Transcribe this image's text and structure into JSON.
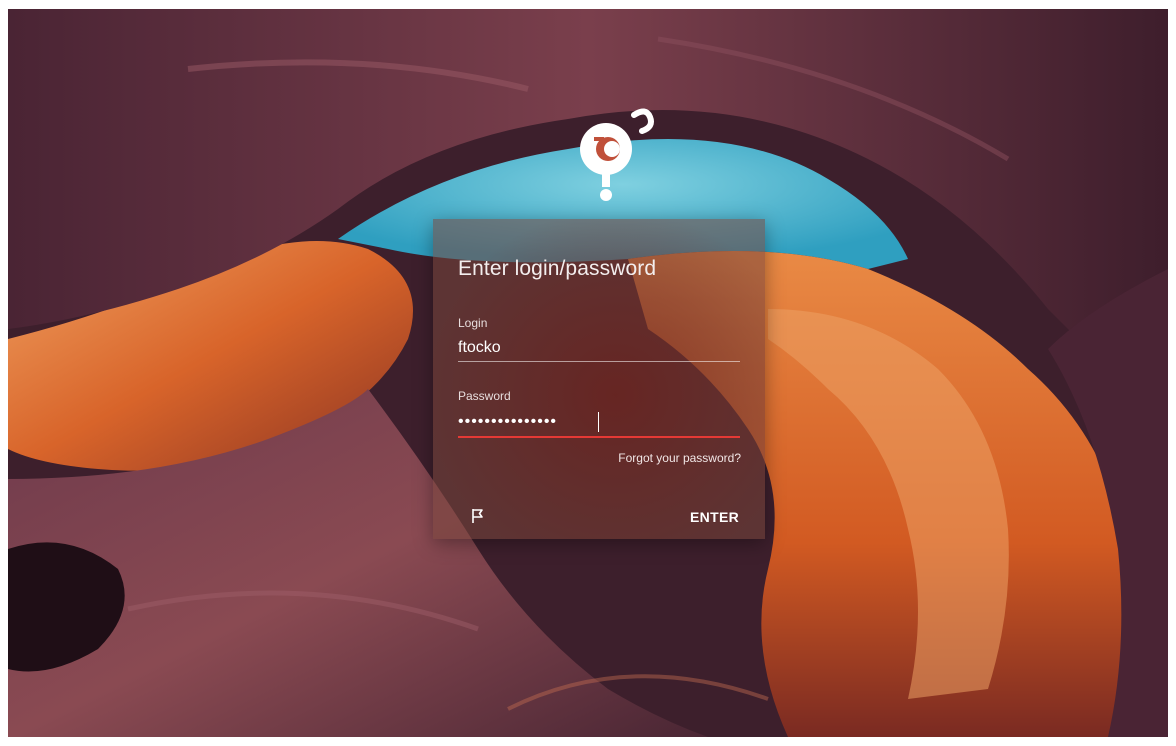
{
  "login_card": {
    "title": "Enter login/password",
    "login_label": "Login",
    "login_value": "ftocko",
    "password_label": "Password",
    "password_value": "•••••••••••••••",
    "forgot_link": "Forgot your password?",
    "enter_label": "ENTER",
    "language_icon": "flag-icon"
  },
  "colors": {
    "accent_underline": "#e53935",
    "sky": "#4fb8d2",
    "rock_orange": "#e86a2a",
    "rock_purple": "#5a2d3e"
  }
}
